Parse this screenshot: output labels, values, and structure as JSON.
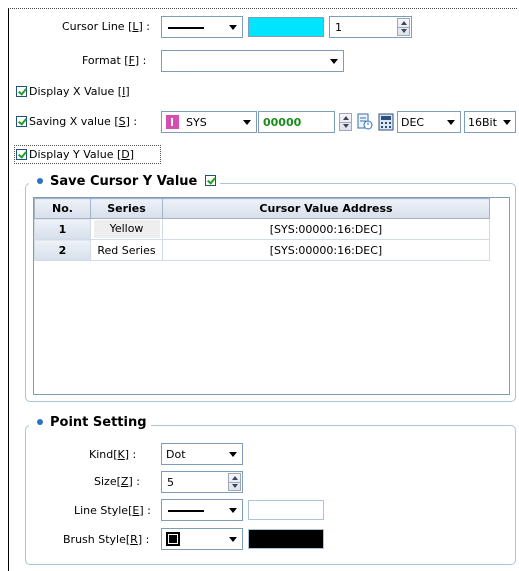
{
  "cursor_line": {
    "label": "Cursor Line ",
    "key": "L",
    "colon": " :",
    "value": "1",
    "color": "#00e5ff"
  },
  "format": {
    "label": "Format ",
    "key": "F",
    "colon": " :",
    "value": ""
  },
  "display_x": {
    "label": "Display X Value ",
    "key": "I",
    "checked": true
  },
  "saving_x": {
    "label": "Saving X value ",
    "key": "S",
    "colon": " :",
    "checked": true,
    "device": "SYS",
    "address": "00000",
    "base": "DEC",
    "bits": "16Bit",
    "address_color": "#1a8c1a",
    "device_icon_color": "#d64fb0"
  },
  "display_y": {
    "label": "Display Y Value ",
    "key": "D",
    "checked": true
  },
  "save_cursor": {
    "title": "Save Cursor Y Value",
    "checked": true,
    "columns": [
      "No.",
      "Series",
      "Cursor Value Address"
    ],
    "rows": [
      {
        "no": "1",
        "series": "Yellow",
        "address": "[SYS:00000:16:DEC]"
      },
      {
        "no": "2",
        "series": "Red Series",
        "address": "[SYS:00000:16:DEC]"
      }
    ]
  },
  "point_setting": {
    "title": "Point Setting",
    "kind": {
      "label": "Kind",
      "key": "K",
      "colon": " :",
      "value": "Dot"
    },
    "size": {
      "label": "Size",
      "key": "Z",
      "colon": " :",
      "value": "5"
    },
    "line_style": {
      "label": "Line Style",
      "key": "E",
      "colon": " :",
      "color": "#ffffff"
    },
    "brush_style": {
      "label": "Brush Style",
      "key": "R",
      "colon": " :",
      "color": "#000000"
    }
  }
}
